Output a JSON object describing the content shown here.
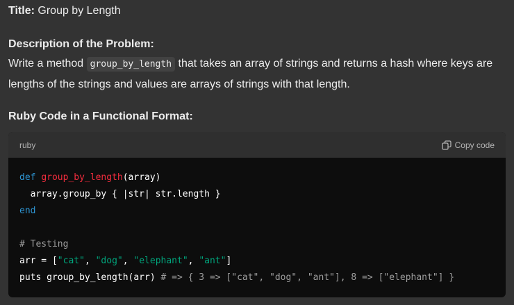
{
  "title": {
    "label": "Title:",
    "value": "Group by Length"
  },
  "description": {
    "heading": "Description of the Problem:",
    "text_before": "Write a method ",
    "inline_code": "group_by_length",
    "text_after": " that takes an array of strings and returns a hash where keys are lengths of the strings and values are arrays of strings with that length."
  },
  "code_section": {
    "heading": "Ruby Code in a Functional Format:",
    "language": "ruby",
    "copy_label": "Copy code",
    "copy_icon": "copy-icon"
  },
  "code": {
    "l1_def": "def",
    "l1_fn": "group_by_length",
    "l1_rest": "(array)",
    "l2": "  array.group_by { |str| str.length }",
    "l3_end": "end",
    "l5_comment": "# Testing",
    "l6_pre": "arr = [",
    "l6_s1": "\"cat\"",
    "l6_s2": "\"dog\"",
    "l6_s3": "\"elephant\"",
    "l6_s4": "\"ant\"",
    "l6_post": "]",
    "l7_code": "puts group_by_length(arr) ",
    "l7_comment": "# => { 3 => [\"cat\", \"dog\", \"ant\"], 8 => [\"elephant\"] }"
  },
  "colors": {
    "background": "#333333",
    "code_background": "#0d0d0d",
    "keyword": "#2e95d3",
    "function_name": "#f22c3d",
    "string": "#00a67d",
    "comment": "#9e9e9e"
  }
}
